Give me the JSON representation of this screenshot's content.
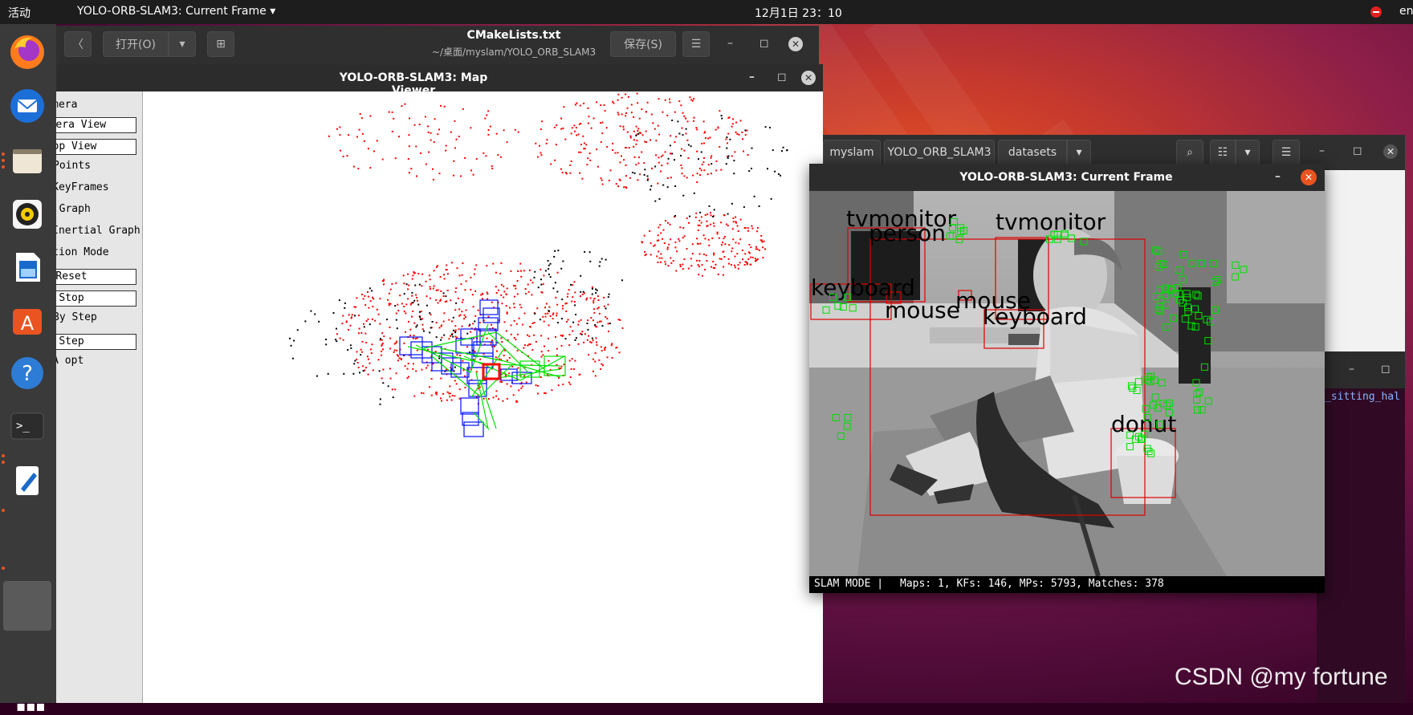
{
  "topbar": {
    "activities": "活动",
    "app_menu": "YOLO-ORB-SLAM3: Current Frame",
    "clock": "12月1日  23：10",
    "lang": "en"
  },
  "dock": {
    "items": [
      "firefox-icon",
      "thunderbird-icon",
      "files-icon",
      "rhythmbox-icon",
      "writer-icon",
      "software-icon",
      "help-icon",
      "terminal-icon",
      "text-editor-icon"
    ]
  },
  "gedit": {
    "open_label": "打开(O)",
    "save_label": "保存(S)",
    "title": "CMakeLists.txt",
    "subtitle": "~/桌面/myslam/YOLO_ORB_SLAM3"
  },
  "map_viewer": {
    "title": "YOLO-ORB-SLAM3: Map Viewer",
    "panel": [
      {
        "kind": "check",
        "label": "ow Camera"
      },
      {
        "kind": "button",
        "label": "Camera View"
      },
      {
        "kind": "button",
        "label": "Top View"
      },
      {
        "kind": "check",
        "label": "Points"
      },
      {
        "kind": "check",
        "label": "Show KeyFrames"
      },
      {
        "kind": "check",
        "label": "w Graph"
      },
      {
        "kind": "check",
        "label": "Show Inertial Graph"
      },
      {
        "kind": "check",
        "label": "alization Mode"
      },
      {
        "kind": "button",
        "label": "Reset"
      },
      {
        "kind": "button",
        "label": "Stop"
      },
      {
        "kind": "check",
        "label": "By Step"
      },
      {
        "kind": "button",
        "label": "Step"
      },
      {
        "kind": "check",
        "label": "ow LBA opt"
      }
    ]
  },
  "files": {
    "path": [
      "myslam",
      "YOLO_ORB_SLAM3",
      "datasets"
    ],
    "term_text": "_sitting_hal"
  },
  "current_frame": {
    "title": "YOLO-ORB-SLAM3: Current Frame",
    "detections": [
      "tvmonitor",
      "person",
      "tvmonitor",
      "keyboard",
      "mouse",
      "mouse",
      "keyboard",
      "donut"
    ],
    "status": {
      "mode": "SLAM MODE |",
      "stats": "Maps: 1, KFs: 146, MPs: 5793, Matches: 378"
    }
  },
  "watermark": "CSDN @my fortune",
  "colors": {
    "ubuntu_orange": "#e95420",
    "keypoint_green": "#00e000",
    "keyframe_blue": "#0000ff",
    "bbox_red": "#e00000",
    "mappoint_red": "#ff0000"
  }
}
